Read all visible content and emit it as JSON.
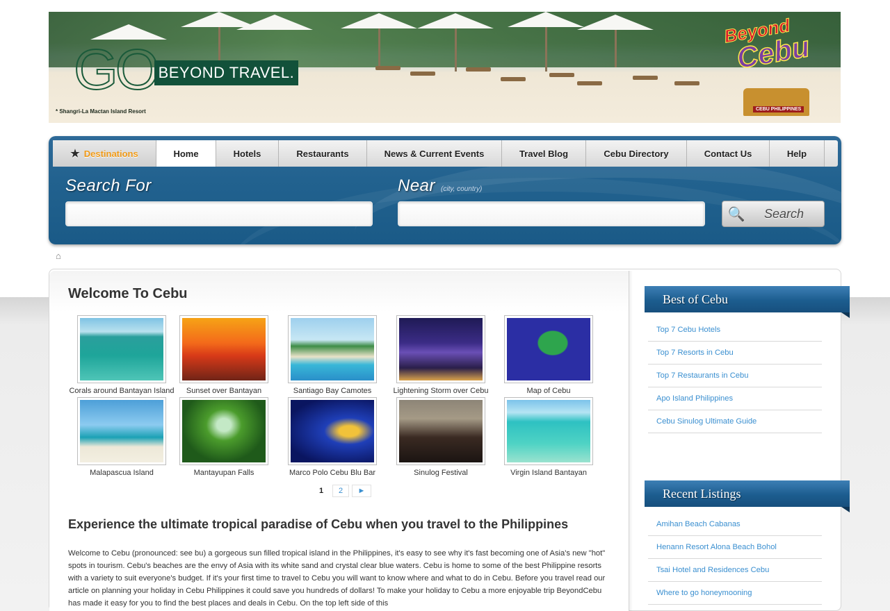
{
  "banner": {
    "logo_go": "GO",
    "logo_tagline": "BEYOND TRAVEL.",
    "caption": "* Shangri-La Mactan Island Resort",
    "brand_beyond": "Beyond",
    "brand_cebu": "Cebu",
    "brand_sign": "CEBU PHILIPPINES"
  },
  "nav": {
    "tabs": [
      {
        "label": "Destinations",
        "icon": "star-icon"
      },
      {
        "label": "Home"
      },
      {
        "label": "Hotels"
      },
      {
        "label": "Restaurants"
      },
      {
        "label": "News & Current Events"
      },
      {
        "label": "Travel Blog"
      },
      {
        "label": "Cebu Directory"
      },
      {
        "label": "Contact Us"
      },
      {
        "label": "Help"
      }
    ],
    "active": "Home"
  },
  "search": {
    "search_for_label": "Search For",
    "near_label": "Near",
    "near_hint": "(city, country)",
    "search_for_value": "",
    "near_value": "",
    "button_label": "Search"
  },
  "main": {
    "title": "Welcome To Cebu",
    "gallery": [
      {
        "caption": "Corals around Bantayan Island"
      },
      {
        "caption": "Sunset over Bantayan"
      },
      {
        "caption": "Santiago Bay Camotes"
      },
      {
        "caption": "Lightening Storm over Cebu"
      },
      {
        "caption": "Map of Cebu"
      },
      {
        "caption": "Malapascua Island"
      },
      {
        "caption": "Mantayupan Falls"
      },
      {
        "caption": "Marco Polo Cebu Blu Bar"
      },
      {
        "caption": "Sinulog Festival"
      },
      {
        "caption": "Virgin Island Bantayan"
      }
    ],
    "pager": {
      "current": "1",
      "next_page": "2",
      "next_arrow": "►"
    },
    "headline": "Experience the ultimate tropical paradise of Cebu when you travel to the Philippines",
    "body": "Welcome to Cebu (pronounced: see bu)  a gorgeous sun filled tropical island in the Philippines,  it's easy to see why it's fast becoming one of Asia's new \"hot\" spots in tourism. Cebu's beaches are the envy of Asia with its white sand and crystal clear blue waters. Cebu is home to some of the best Philippine resorts with a variety to suit everyone's budget. If it's your first time to travel to Cebu you will want to know where and what to do in Cebu. Before you travel read our article on planning your holiday in Cebu Philippines it could save you hundreds of dollars! To make your holiday to Cebu a more enjoyable trip BeyondCebu has made it easy for you to find the best places and deals in Cebu. On the top left side of this"
  },
  "sidebar": {
    "best": {
      "title": "Best of Cebu",
      "links": [
        "Top 7 Cebu Hotels",
        "Top 7 Resorts in Cebu",
        "Top 7 Restaurants in Cebu",
        "Apo Island Philippines",
        "Cebu Sinulog Ultimate Guide"
      ]
    },
    "recent": {
      "title": "Recent Listings",
      "links": [
        "Amihan Beach Cabanas",
        "Henann Resort Alona Beach Bohol",
        "Tsai Hotel and Residences Cebu",
        "Where to go honeymooning"
      ]
    }
  },
  "colors": {
    "nav_blue": "#1f5f8d",
    "link_blue": "#3a8fd0",
    "accent_orange": "#f09a17"
  }
}
